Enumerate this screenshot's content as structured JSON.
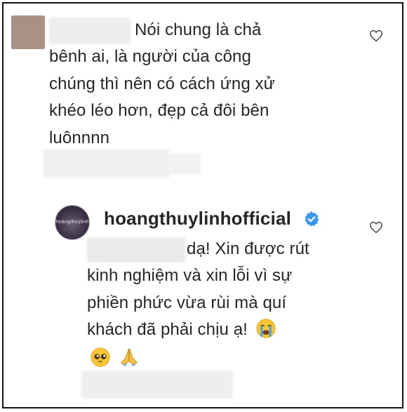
{
  "comment": {
    "lines": [
      "Nói chung là chả",
      "bênh ai, là người của công",
      "chúng thì nên có cách ứng xử",
      "khéo léo hơn, đẹp cả đôi bên",
      "luônnnn"
    ]
  },
  "reply": {
    "username": "hoangthuylinhofficial",
    "first_line": "dạ! Xin được rút",
    "lines": [
      "kinh nghiệm và xin lỗi vì sự",
      "phiền phức vừa rùi mà quí",
      "khách đã phải chịu ạ!"
    ],
    "emojis": [
      "crying-face",
      "pleading-face",
      "folded-hands"
    ]
  },
  "icons": {
    "comment_like": "heart-outline-icon",
    "reply_like": "heart-outline-icon",
    "verified": "verified-badge-icon"
  }
}
